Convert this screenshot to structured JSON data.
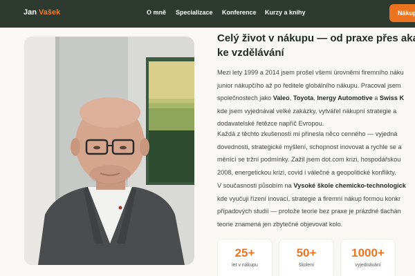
{
  "nav": {
    "logo_first": "Jan",
    "logo_last": "Vašek",
    "links": [
      "O mně",
      "Specializace",
      "Konference",
      "Kurzy a knihy"
    ],
    "cta": "Nákupn"
  },
  "headline": [
    "Celý život v nákupu — od praxe přes akad",
    "ke vzdělávání"
  ],
  "para1": {
    "line1": "Mezi lety 1999 a 2014 jsem prošel všemi úrovněmi firemního náku",
    "line2": "junior nákupčího až po ředitele globálního nákupu. Pracoval jsem",
    "line3_pre": "společnostech jako ",
    "brands": [
      "Valeo",
      "Toyota",
      "Inergy Automotive",
      "Swiss K"
    ],
    "sep_comma": ", ",
    "and": " a ",
    "line4": "kde jsem vyjednával velké zakázky, vytvářel nákupní strategie a",
    "line5": "dodavatelské řetězce napříč Evropou."
  },
  "para2": [
    "Každá z těchto zkušeností mi přinesla něco cenného — vyjedná",
    "dovednosti, strategické myšlení, schopnost inovovat a rychle se a",
    "měnící se tržní podmínky. Zažil jsem dot.com krizi, hospodářskou",
    "2008, energetickou krizi, covid i válečné a geopolitické konflikty."
  ],
  "para3": {
    "line1_pre": "V současnosti působím na ",
    "school": "Vysoké škole chemicko-technologick",
    "line2": "kde vyučuji řízení inovací, strategie a firemní nákup formou konkr",
    "line3": "případových studií — protože teorie bez praxe je prázdné tlachán",
    "line4": "teorie znamená jen zbytečné objevovat kolo."
  },
  "stats": [
    {
      "value": "25+",
      "label": "let v nákupu"
    },
    {
      "value": "50+",
      "label": "školení"
    },
    {
      "value": "1000+",
      "label": "vyjednávání"
    }
  ],
  "colors": {
    "accent": "#ec7420",
    "nav_bg": "#2e3a30",
    "page_bg": "#faf8f5"
  }
}
